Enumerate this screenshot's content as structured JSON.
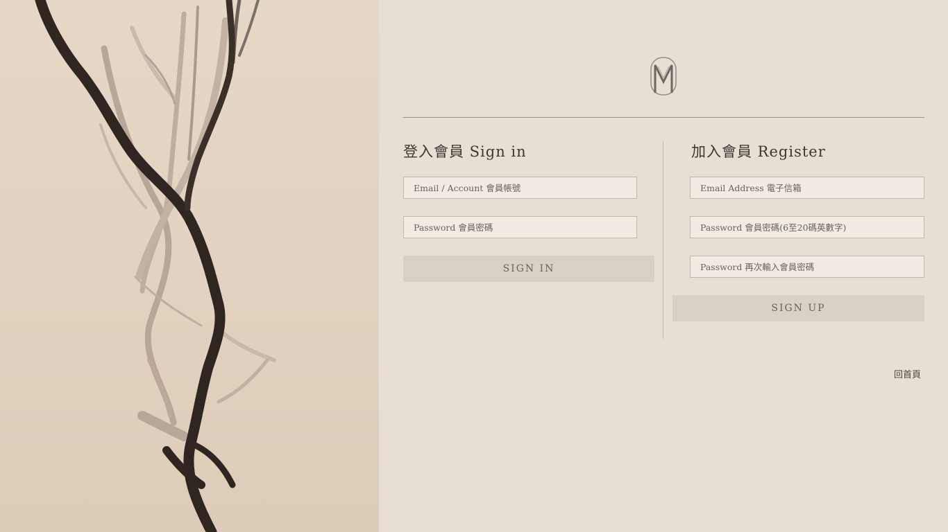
{
  "signin": {
    "heading": "登入會員 Sign in",
    "account_placeholder": "Email / Account 會員帳號",
    "password_placeholder": "Password 會員密碼",
    "button_label": "SIGN IN"
  },
  "register": {
    "heading": "加入會員 Register",
    "email_placeholder": "Email Address 電子信箱",
    "password_placeholder": "Password 會員密碼(6至20碼英數字)",
    "confirm_placeholder": "Password 再次輸入會員密碼",
    "button_label": "SIGN UP"
  },
  "footer": {
    "home_link": "回首頁"
  },
  "colors": {
    "background": "#e8dfd4",
    "field_background": "#f1ebe4",
    "field_border": "#c4b6a9",
    "button_background": "#d9d0c7",
    "text_dark": "#3c3632"
  },
  "icons": {
    "logo": "monogram-m-logo"
  }
}
